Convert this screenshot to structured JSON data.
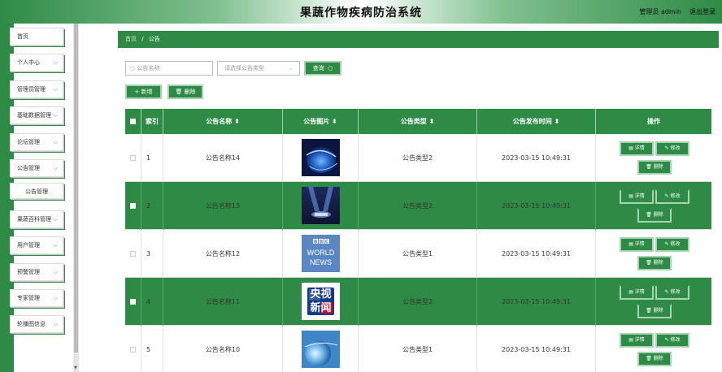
{
  "header": {
    "title": "果蔬作物疾病防治系统",
    "admin": "管理员 admin",
    "logout": "退出登录"
  },
  "sidebar": {
    "items": [
      {
        "label": "首页",
        "chevron": false
      },
      {
        "label": "个人中心",
        "chevron": true
      },
      {
        "label": "管理员管理",
        "chevron": true
      },
      {
        "label": "基础数据管理",
        "chevron": true
      },
      {
        "label": "论坛管理",
        "chevron": true
      },
      {
        "label": "公告管理",
        "chevron": true
      },
      {
        "label": "果蔬百科管理",
        "chevron": true
      },
      {
        "label": "用户管理",
        "chevron": true
      },
      {
        "label": "预警管理",
        "chevron": true
      },
      {
        "label": "专家管理",
        "chevron": true
      },
      {
        "label": "轮播图信息",
        "chevron": true
      }
    ],
    "subitem": "公告管理"
  },
  "breadcrumb": {
    "home": "首页",
    "sep": "/",
    "current": "公告"
  },
  "search": {
    "name_placeholder": "公告名称",
    "type_placeholder": "请选择公告类型",
    "query_label": "查询"
  },
  "actions": {
    "add_label": "新增",
    "delete_label": "删除"
  },
  "table": {
    "headers": {
      "index": "索引",
      "name": "公告名称",
      "image": "公告图片",
      "type": "公告类型",
      "time": "公告发布时间",
      "ops": "操作"
    },
    "sort_icon": "⬍",
    "op_labels": {
      "detail": "详情",
      "edit": "修改",
      "delete": "删除"
    },
    "rows": [
      {
        "index": "1",
        "name": "公告名称14",
        "type": "公告类型2",
        "time": "2023-03-15 10:49:31",
        "image": "blue-tech-globe"
      },
      {
        "index": "2",
        "name": "公告名称13",
        "type": "公告类型2",
        "time": "2023-03-15 10:49:31",
        "image": "news-studio-spotlights"
      },
      {
        "index": "3",
        "name": "公告名称12",
        "type": "公告类型1",
        "time": "2023-03-15 10:49:31",
        "image": "bbc-world-news"
      },
      {
        "index": "4",
        "name": "公告名称11",
        "type": "公告类型2",
        "time": "2023-03-15 10:49:31",
        "image": "cctv-news-logo"
      },
      {
        "index": "5",
        "name": "公告名称10",
        "type": "公告类型1",
        "time": "2023-03-15 10:49:31",
        "image": "news-globe-light"
      }
    ]
  },
  "colors": {
    "primary": "#2e8b46",
    "accent_border": "#a9d4b3"
  }
}
